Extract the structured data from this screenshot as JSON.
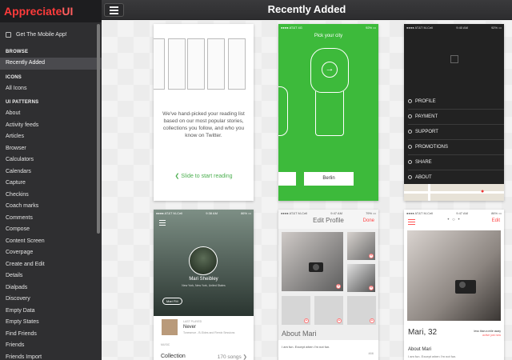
{
  "brand": {
    "part1": "Appreciate",
    "part2": "UI"
  },
  "sidebar": {
    "mobile_link": "Get The Mobile App!",
    "sections": [
      {
        "title": "BROWSE",
        "items": [
          {
            "label": "Recently Added",
            "active": true
          }
        ]
      },
      {
        "title": "ICONS",
        "items": [
          {
            "label": "All Icons",
            "active": false
          }
        ]
      },
      {
        "title": "UI PATTERNS",
        "items": [
          {
            "label": "About"
          },
          {
            "label": "Activity feeds"
          },
          {
            "label": "Articles"
          },
          {
            "label": "Browser"
          },
          {
            "label": "Calculators"
          },
          {
            "label": "Calendars"
          },
          {
            "label": "Capture"
          },
          {
            "label": "Checkins"
          },
          {
            "label": "Coach marks"
          },
          {
            "label": "Comments"
          },
          {
            "label": "Compose"
          },
          {
            "label": "Content Screen"
          },
          {
            "label": "Coverpage"
          },
          {
            "label": "Create and Edit"
          },
          {
            "label": "Details"
          },
          {
            "label": "Dialpads"
          },
          {
            "label": "Discovery"
          },
          {
            "label": "Empty Data"
          },
          {
            "label": "Empty States"
          },
          {
            "label": "Find Friends"
          },
          {
            "label": "Friends"
          },
          {
            "label": "Friends Import"
          }
        ]
      }
    ]
  },
  "header": {
    "title": "Recently Added"
  },
  "cards": {
    "c1": {
      "text": "We've hand-picked your reading list based on our most popular stories, collections you follow, and who you know on Twitter.",
      "slide": "❮  Slide to start reading"
    },
    "c2": {
      "status_left": "●●●● AT&T  4G",
      "status_right": "92% ▭",
      "title": "Pick your city",
      "city": "Berlin"
    },
    "c3": {
      "status_left": "●●●● AT&T M-Cell",
      "status_time": "9:40 AM",
      "status_right": "92% ▭",
      "menu": [
        "PROFILE",
        "PAYMENT",
        "SUPPORT",
        "PROMOTIONS",
        "SHARE",
        "ABOUT"
      ]
    },
    "c4": {
      "status_left": "●●●● AT&T M-Cell",
      "status_time": "9:38 AM",
      "status_right": "86% ▭",
      "name": "Mari Sheibley",
      "location": "New York, New York, United States",
      "chip": "Mari FM",
      "song_label": "LAST PLAYED",
      "song": "Never",
      "song_sub": "Tonesmoe - B-Sides and Remix Sessions",
      "music_label": "MUSIC",
      "collection": "Collection",
      "collection_count": "170 songs  ❯"
    },
    "c5": {
      "status_left": "●●●● AT&T M-Cell",
      "status_time": "9:47 AM",
      "status_right": "79% ▭",
      "title": "Edit Profile",
      "done": "Done",
      "about": "About Mari",
      "about_text": "I am fun. Except when I'm not fun.",
      "count": "466"
    },
    "c6": {
      "status_left": "●●●● AT&T M-Cell",
      "status_time": "9:47 AM",
      "status_right": "86% ▭",
      "dots": "• ○ •",
      "edit": "Edit",
      "name": "Mari, 32",
      "distance": "less than a mile away",
      "active": "active just now",
      "about": "About Mari",
      "about_text": "I am fun. Except when I'm not fun."
    }
  },
  "colors": {
    "accent": "#ff3b3b",
    "green": "#3dba3b",
    "dark": "#2f2f31"
  }
}
